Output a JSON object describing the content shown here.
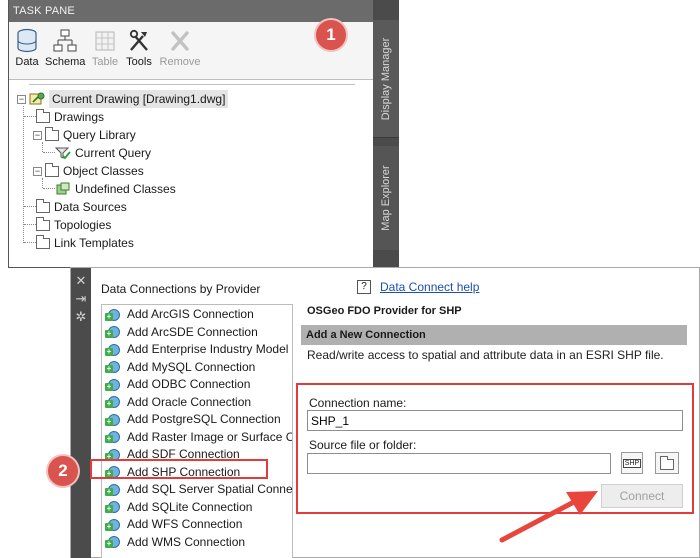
{
  "task_pane": {
    "title": "TASK PANE",
    "toolbar": [
      {
        "label": "Data",
        "icon": "database-icon",
        "enabled": true
      },
      {
        "label": "Schema",
        "icon": "schema-icon",
        "enabled": true
      },
      {
        "label": "Table",
        "icon": "table-icon",
        "enabled": false
      },
      {
        "label": "Tools",
        "icon": "tools-icon",
        "enabled": true
      },
      {
        "label": "Remove",
        "icon": "remove-icon",
        "enabled": false
      }
    ],
    "side_tabs": [
      "Display Manager",
      "Map Explorer"
    ],
    "tree": {
      "root": "Current Drawing [Drawing1.dwg]",
      "items": [
        "Drawings",
        "Query Library",
        "Current Query",
        "Object Classes",
        "Undefined Classes",
        "Data Sources",
        "Topologies",
        "Link Templates"
      ]
    }
  },
  "data_connect": {
    "left_title": "Data Connections by Provider",
    "providers": [
      "Add ArcGIS Connection",
      "Add ArcSDE Connection",
      "Add Enterprise Industry Model C",
      "Add MySQL Connection",
      "Add ODBC Connection",
      "Add Oracle Connection",
      "Add PostgreSQL Connection",
      "Add Raster Image or Surface Co",
      "Add SDF Connection",
      "Add SHP Connection",
      "Add SQL Server Spatial Connect",
      "Add SQLite Connection",
      "Add WFS Connection",
      "Add WMS Connection"
    ],
    "help_icon": "?",
    "help_link": "Data Connect help",
    "provider_title": "OSGeo FDO Provider for SHP",
    "section_title": "Add a New Connection",
    "section_desc": "Read/write access to spatial and attribute data in an ESRI SHP file.",
    "connection_name_label": "Connection name:",
    "connection_name_value": "SHP_1",
    "source_label": "Source file or folder:",
    "source_value": "",
    "shp_button_text": "SHP",
    "connect_button": "Connect"
  },
  "annotations": {
    "badge1": "1",
    "badge2": "2",
    "color": "#e23b3b"
  }
}
